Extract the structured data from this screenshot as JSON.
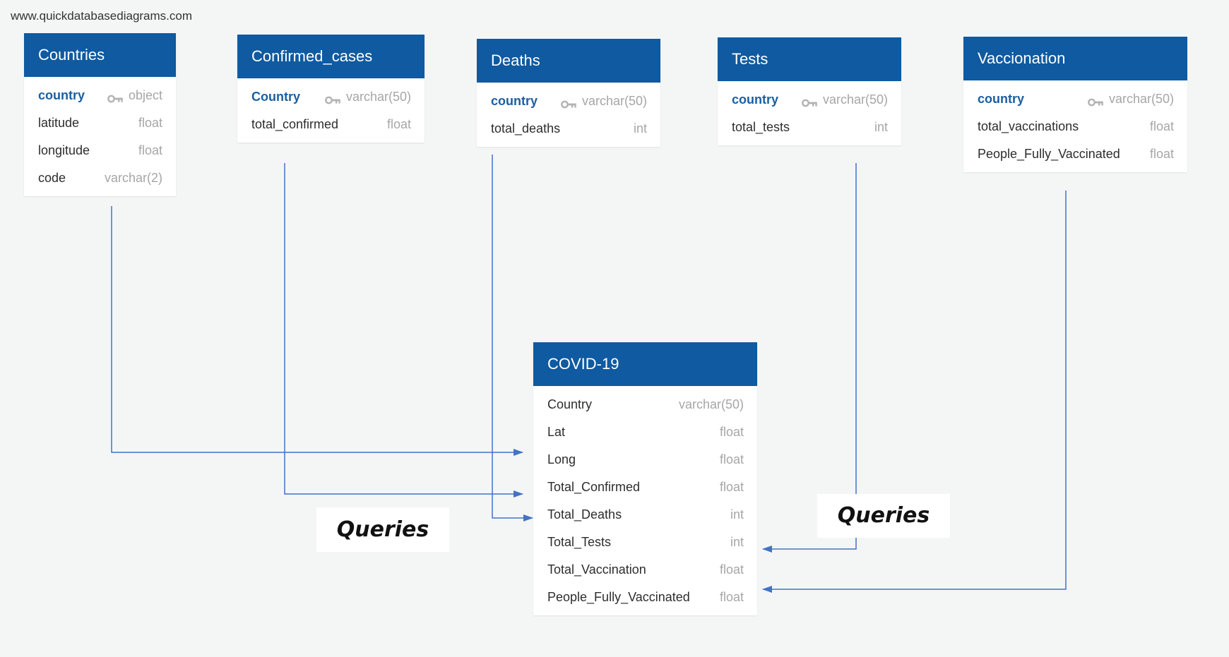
{
  "watermark": "www.quickdatabasediagrams.com",
  "tables": {
    "countries": {
      "title": "Countries",
      "fields": [
        {
          "name": "country",
          "type": "object",
          "pk": true
        },
        {
          "name": "latitude",
          "type": "float"
        },
        {
          "name": "longitude",
          "type": "float"
        },
        {
          "name": "code",
          "type": "varchar(2)"
        }
      ]
    },
    "confirmed_cases": {
      "title": "Confirmed_cases",
      "fields": [
        {
          "name": "Country",
          "type": "varchar(50)",
          "pk": true
        },
        {
          "name": "total_confirmed",
          "type": "float"
        }
      ]
    },
    "deaths": {
      "title": "Deaths",
      "fields": [
        {
          "name": "country",
          "type": "varchar(50)",
          "pk": true
        },
        {
          "name": "total_deaths",
          "type": "int"
        }
      ]
    },
    "tests": {
      "title": "Tests",
      "fields": [
        {
          "name": "country",
          "type": "varchar(50)",
          "pk": true
        },
        {
          "name": "total_tests",
          "type": "int"
        }
      ]
    },
    "vaccionation": {
      "title": "Vaccionation",
      "fields": [
        {
          "name": "country",
          "type": "varchar(50)",
          "pk": true
        },
        {
          "name": "total_vaccinations",
          "type": "float"
        },
        {
          "name": "People_Fully_Vaccinated",
          "type": "float"
        }
      ]
    },
    "covid19": {
      "title": "COVID-19",
      "fields": [
        {
          "name": "Country",
          "type": "varchar(50)"
        },
        {
          "name": "Lat",
          "type": "float"
        },
        {
          "name": "Long",
          "type": "float"
        },
        {
          "name": "Total_Confirmed",
          "type": "float"
        },
        {
          "name": "Total_Deaths",
          "type": "int"
        },
        {
          "name": "Total_Tests",
          "type": "int"
        },
        {
          "name": "Total_Vaccination",
          "type": "float"
        },
        {
          "name": "People_Fully_Vaccinated",
          "type": "float"
        }
      ]
    }
  },
  "annotations": {
    "queries_left": "Queries",
    "queries_right": "Queries"
  },
  "colors": {
    "header": "#0f5aa0",
    "connector": "#4472c4",
    "background": "#f4f6f6"
  },
  "icons": {
    "primary_key": "key-icon"
  }
}
